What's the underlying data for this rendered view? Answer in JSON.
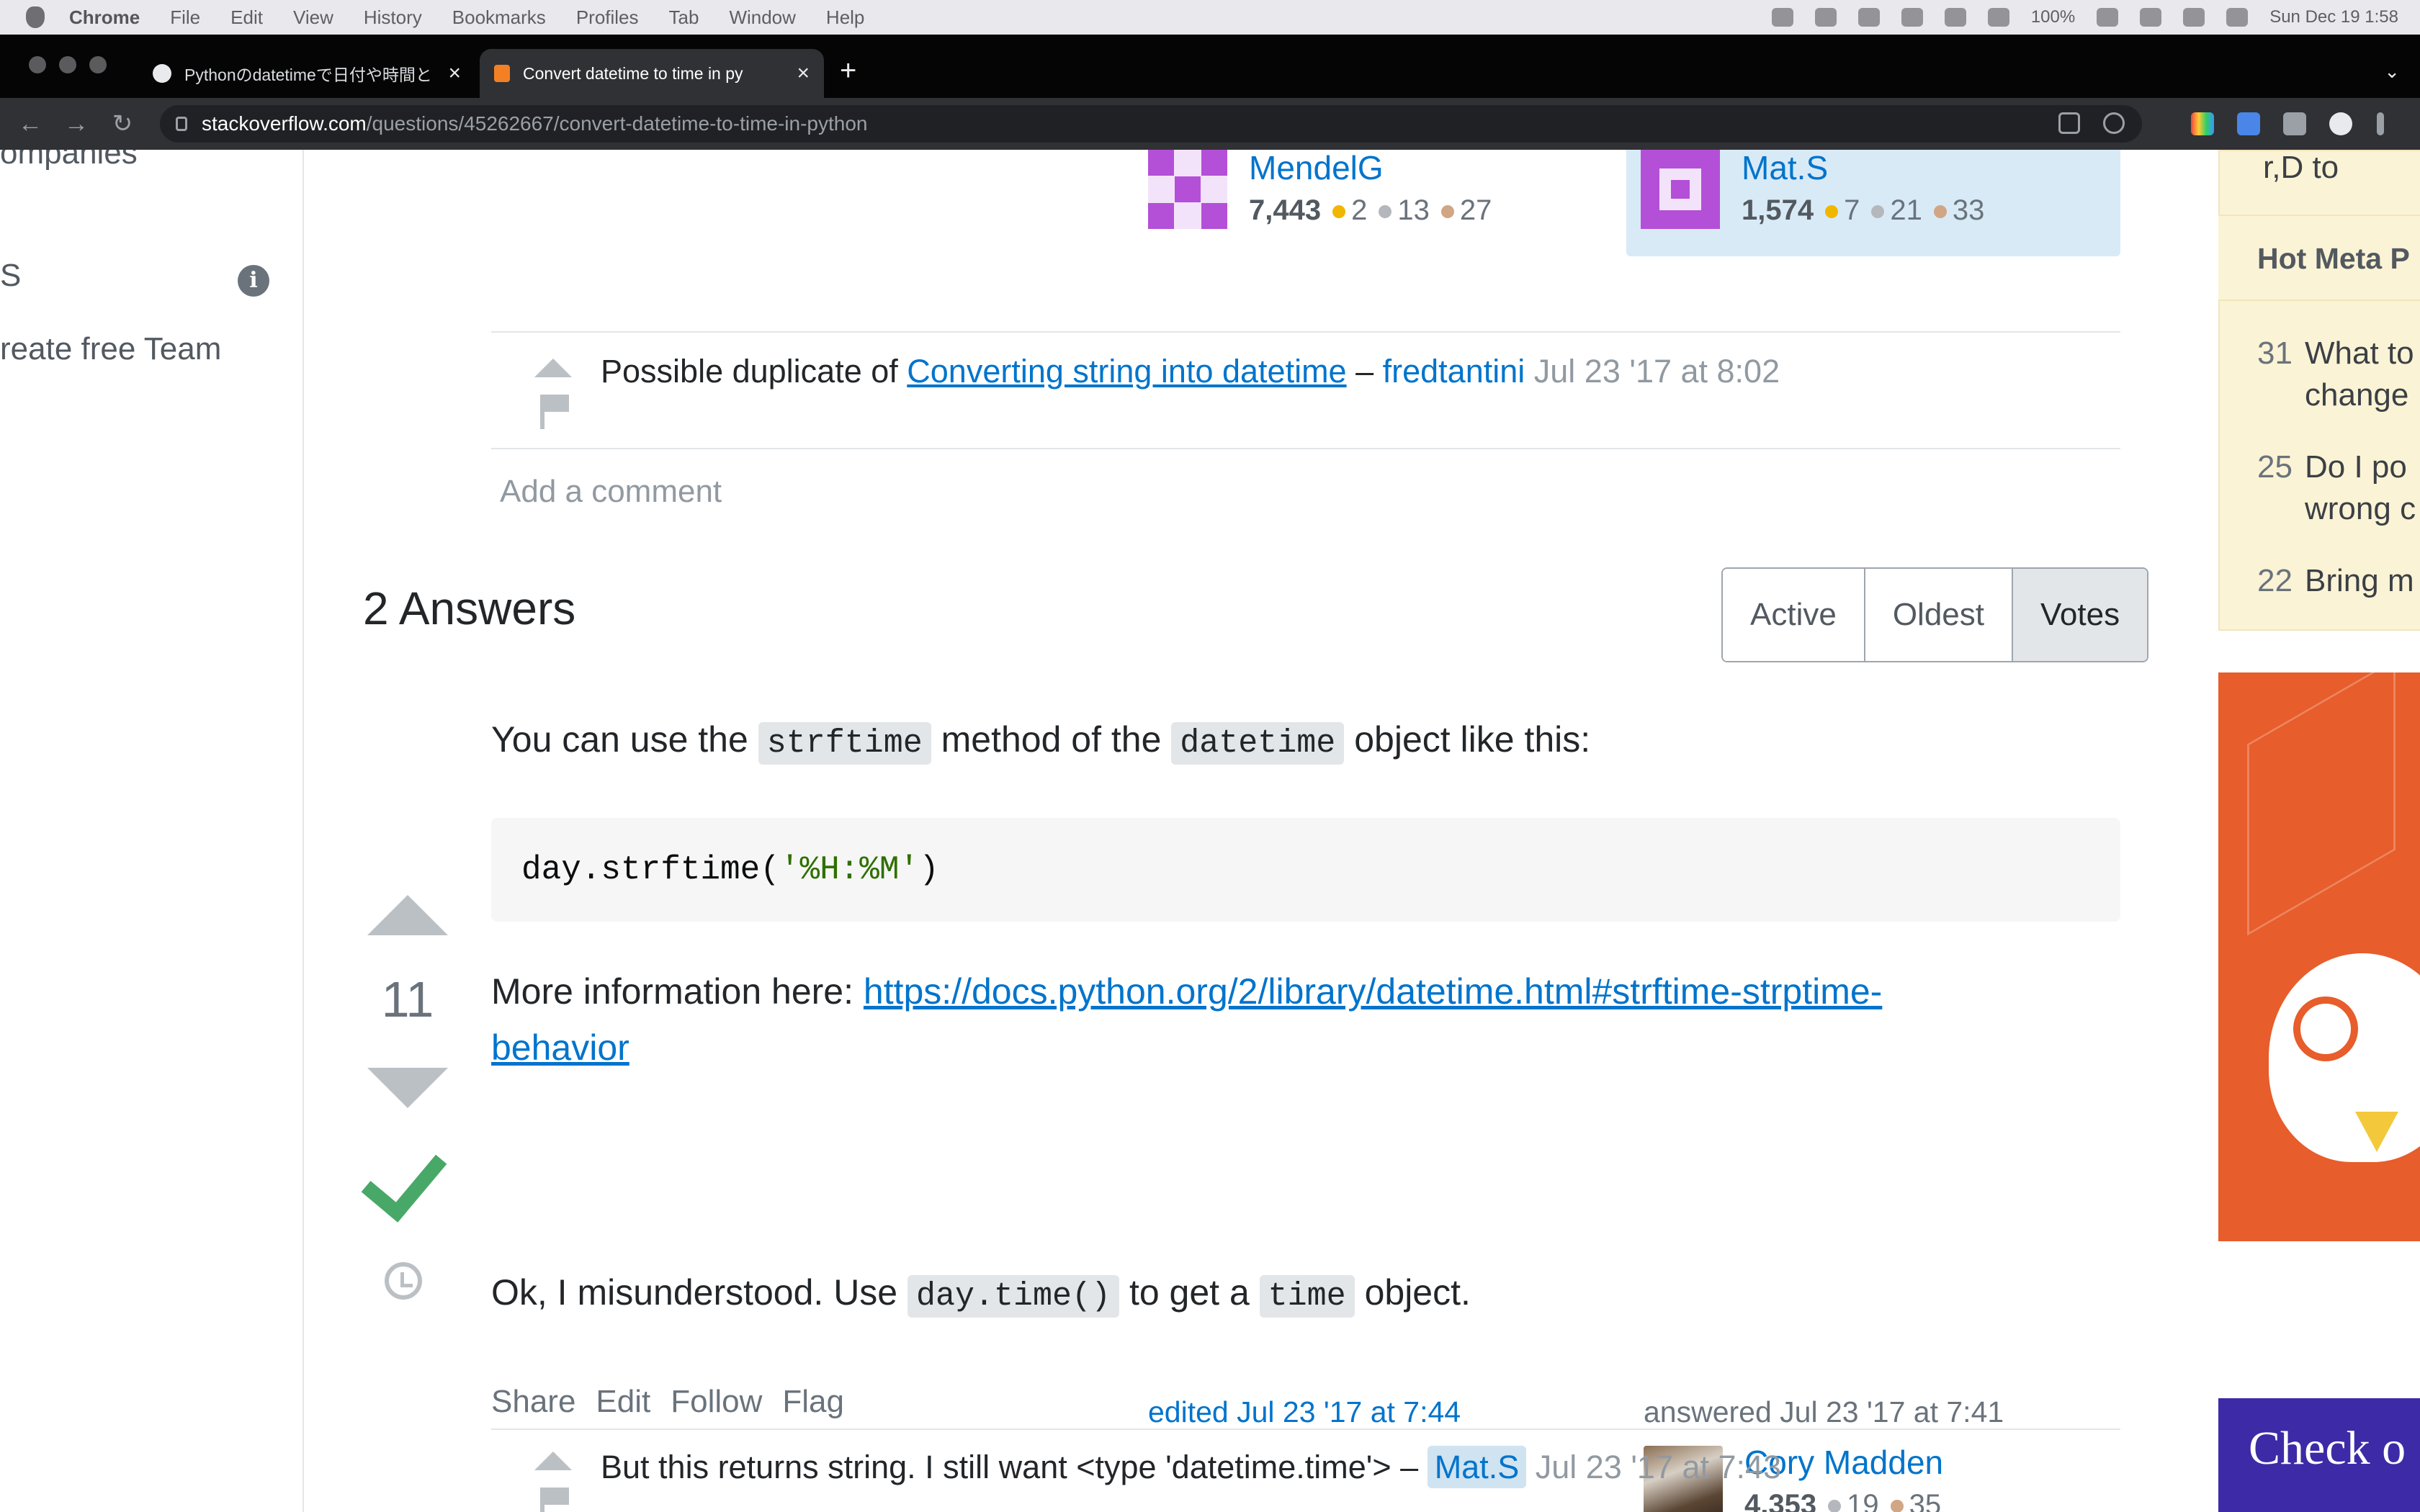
{
  "menubar": {
    "app": "Chrome",
    "items": [
      "File",
      "Edit",
      "View",
      "History",
      "Bookmarks",
      "Profiles",
      "Tab",
      "Window",
      "Help"
    ],
    "battery": "100%",
    "datetime": "Sun Dec 19  1:58"
  },
  "tabs": [
    {
      "title": "Pythonのdatetimeで日付や時間と",
      "close": "×"
    },
    {
      "title": "Convert datetime to time in py",
      "close": "×"
    }
  ],
  "new_tab": "+",
  "address": {
    "host": "stackoverflow.com",
    "path": "/questions/45262667/convert-datetime-to-time-in-python"
  },
  "left_nav": {
    "companies": "ompanies",
    "teams_fragment": "S",
    "create_team": "reate free Team",
    "info_icon": "i"
  },
  "question_users": [
    {
      "name": "MendelG",
      "rep": "7,443",
      "gold": "2",
      "silver": "13",
      "bronze": "27"
    },
    {
      "name": "Mat.S",
      "rep": "1,574",
      "gold": "7",
      "silver": "21",
      "bronze": "33"
    }
  ],
  "question_comment": {
    "prefix": "Possible duplicate of ",
    "link": "Converting string into datetime",
    "sep": " – ",
    "user": "fredtantini",
    "time": "Jul 23 '17 at 8:02"
  },
  "add_comment": "Add a comment",
  "answers": {
    "title": "2 Answers",
    "sort": [
      "Active",
      "Oldest",
      "Votes"
    ],
    "selected_sort": "Votes"
  },
  "answer": {
    "votes": "11",
    "p1": {
      "a": "You can use the ",
      "code1": "strftime",
      "b": " method of the ",
      "code2": "datetime",
      "c": " object like this:"
    },
    "code": {
      "a": "day.strftime(",
      "str": "'%H:%M'",
      "b": ")"
    },
    "p2": {
      "a": "More information here: ",
      "link1": "https://docs.python.org/2/library/datetime.html#strftime-strptime-",
      "link2": "behavior"
    },
    "p3": {
      "a": "Ok, I misunderstood. Use ",
      "code1": "day.time()",
      "b": " to get a ",
      "code2": "time",
      "c": " object."
    },
    "menu": [
      "Share",
      "Edit",
      "Follow",
      "Flag"
    ],
    "edited": "edited Jul 23 '17 at 7:44",
    "answered": "answered Jul 23 '17 at 7:41",
    "author": {
      "name": "Cory Madden",
      "rep": "4,353",
      "silver": "19",
      "bronze": "35"
    }
  },
  "answer_comment": {
    "text": "But this returns string. I still want <type 'datetime.time'> – ",
    "user": "Mat.S",
    "time": "Jul 23 '17 at 7:43"
  },
  "sidebar": {
    "meta_head": "Hot Meta P",
    "top_fragment": "r,D to",
    "items": [
      {
        "num": "31",
        "line1": "What to",
        "line2": "change"
      },
      {
        "num": "25",
        "line1": "Do I po",
        "line2": "wrong c"
      },
      {
        "num": "22",
        "line1": "Bring m",
        "line2": ""
      }
    ],
    "checkout": "Check o"
  }
}
